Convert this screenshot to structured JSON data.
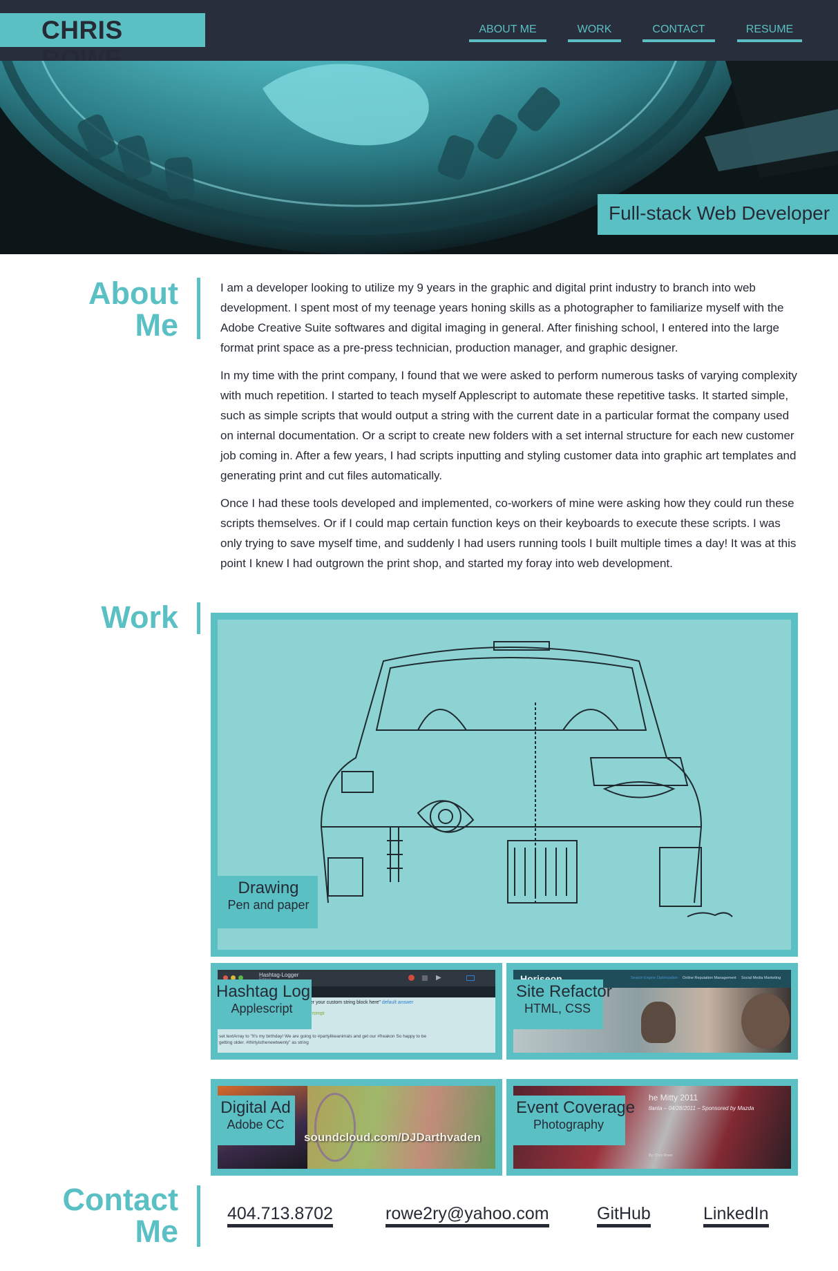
{
  "header": {
    "brand": "CHRIS ROWE",
    "nav": [
      "ABOUT ME",
      "WORK",
      "CONTACT",
      "RESUME"
    ]
  },
  "hero": {
    "tagline": "Full-stack Web Developer"
  },
  "about": {
    "title_line1": "About",
    "title_line2": "Me",
    "paragraphs": [
      "I am a developer looking to utilize my 9 years in the graphic and digital print industry to branch into web development. I spent most of my teenage years honing skills as a photographer to familiarize myself with the Adobe Creative Suite softwares and digital imaging in general. After finishing school, I entered into the large format print space as a pre-press technician, production manager, and graphic designer.",
      "In my time with the print company, I found that we were asked to perform numerous tasks of varying complexity with much repetition. I started to teach myself Applescript to automate these repetitive tasks. It started simple, such as simple scripts that would output a string with the current date in a particular format the company used on internal documentation. Or a script to create new folders with a set internal structure for each new customer job coming in. After a few years, I had scripts inputting and styling customer data into graphic art templates and generating print and cut files automatically.",
      "Once I had these tools developed and implemented, co-workers of mine were asking how they could run these scripts themselves. Or if I could map certain function keys on their keyboards to execute these scripts. I was only trying to save myself time, and suddenly I had users running tools I built multiple times a day! It was at this point I knew I had outgrown the print shop, and started my foray into web development."
    ]
  },
  "work": {
    "title": "Work",
    "items": [
      {
        "title": "Drawing",
        "subtitle": "Pen and paper"
      },
      {
        "title": "Hashtag Log",
        "subtitle": "Applescript"
      },
      {
        "title": "Site Refactor",
        "subtitle": "HTML, CSS"
      },
      {
        "title": "Digital Ad",
        "subtitle": "Adobe CC"
      },
      {
        "title": "Event Coverage",
        "subtitle": "Photography"
      }
    ],
    "thumb_text": {
      "hashtag_window": "Hashtag-Logger",
      "hashtag_sub": "Edited",
      "hashtag_line1": "nter your custom string block here\"",
      "hashtag_link": "default answer",
      "hashtag_prompt": "gPrompt",
      "hashtag_line2": "set textArray to \"It's my birthday! We are going to #partylikeanimals and get our #freakon So happy to be",
      "hashtag_line3": "getting older. #thirtyisthenewtwenty\" as string",
      "site_brand": "Horiseon",
      "site_nav": [
        "Search Engine Optimization",
        "Online Reputation Management",
        "Social Media Marketing"
      ],
      "ad_text": "soundcloud.com/DJDarthvaden",
      "event_title": "he Mitty 2011",
      "event_sub": "tlanta – 04/28/2011 – Sponsored by Mazda",
      "event_by": "By: Chris Rowe"
    }
  },
  "contact": {
    "title_line1": "Contact",
    "title_line2": "Me",
    "links": [
      "404.713.8702",
      "rowe2ry@yahoo.com",
      "GitHub",
      "LinkedIn"
    ]
  },
  "colors": {
    "accent": "#5bc0c4",
    "dark": "#282e3b",
    "text": "#252a35"
  }
}
